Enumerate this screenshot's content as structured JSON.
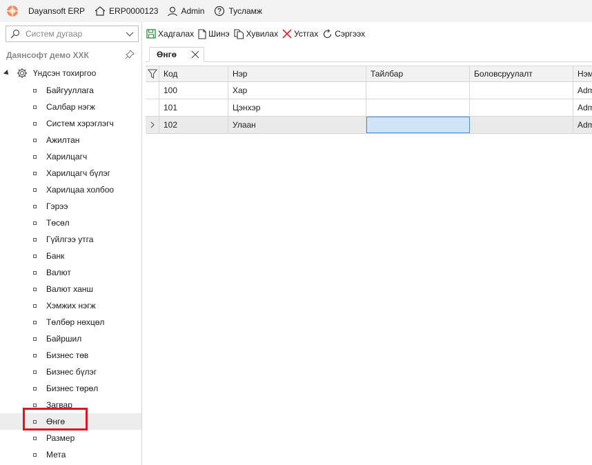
{
  "titlebar": {
    "app_name": "Dayansoft ERP",
    "db_code": "ERP0000123",
    "user": "Admin",
    "help": "Тусламж"
  },
  "search": {
    "placeholder": "Систем дугаар"
  },
  "panel": {
    "title": "Даянсофт демо ХХК"
  },
  "tree": {
    "root_label": "Үндсэн тохиргоо",
    "items": [
      "Байгууллага",
      "Салбар нэгж",
      "Систем хэрэглэгч",
      "Ажилтан",
      "Харилцагч",
      "Харилцагч бүлэг",
      "Харилцаа холбоо",
      "Гэрээ",
      "Төсөл",
      "Гүйлгээ утга",
      "Банк",
      "Валют",
      "Валют ханш",
      "Хэмжих нэгж",
      "Төлбөр нөхцөл",
      "Байршил",
      "Бизнес төв",
      "Бизнес бүлэг",
      "Бизнес төрөл",
      "Загвар",
      "Өнгө",
      "Размер",
      "Мета"
    ],
    "selected": "Өнгө"
  },
  "toolbar": {
    "save": "Хадгалах",
    "new": "Шинэ",
    "copy": "Хувилах",
    "delete": "Устгах",
    "refresh": "Сэргээх"
  },
  "tab": {
    "label": "Өнгө"
  },
  "grid": {
    "columns": [
      "Код",
      "Нэр",
      "Тайлбар",
      "Боловсруулалт",
      "Нэм"
    ],
    "rows": [
      [
        "100",
        "Хар",
        "",
        "",
        "Adm"
      ],
      [
        "101",
        "Цэнхэр",
        "",
        "",
        "Adm"
      ],
      [
        "102",
        "Улаан",
        "",
        "",
        "Adm"
      ]
    ]
  },
  "colors": {
    "accent_red": "#e0141e",
    "selection": "#cfe4f7",
    "save_green": "#2e8b3a",
    "delete_red": "#d9252b"
  }
}
